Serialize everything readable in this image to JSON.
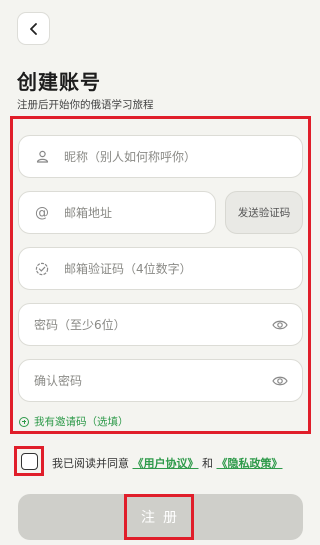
{
  "header": {
    "title": "创建账号",
    "subtitle": "注册后开始你的俄语学习旅程"
  },
  "form": {
    "nickname_placeholder": "昵称（别人如何称呼你）",
    "email_placeholder": "邮箱地址",
    "send_code_label": "发送验证码",
    "code_placeholder": "邮箱验证码（4位数字）",
    "password_placeholder": "密码（至少6位）",
    "confirm_placeholder": "确认密码",
    "invite_label": "我有邀请码（选填）"
  },
  "agreement": {
    "prefix": "我已阅读并同意",
    "user_agreement": "《用户协议》",
    "and": "和",
    "privacy_policy": "《隐私政策》"
  },
  "register_label": "注册",
  "colors": {
    "accent_green": "#2e9a4a",
    "highlight_red": "#e01e2a",
    "button_disabled": "#cfcfca"
  }
}
